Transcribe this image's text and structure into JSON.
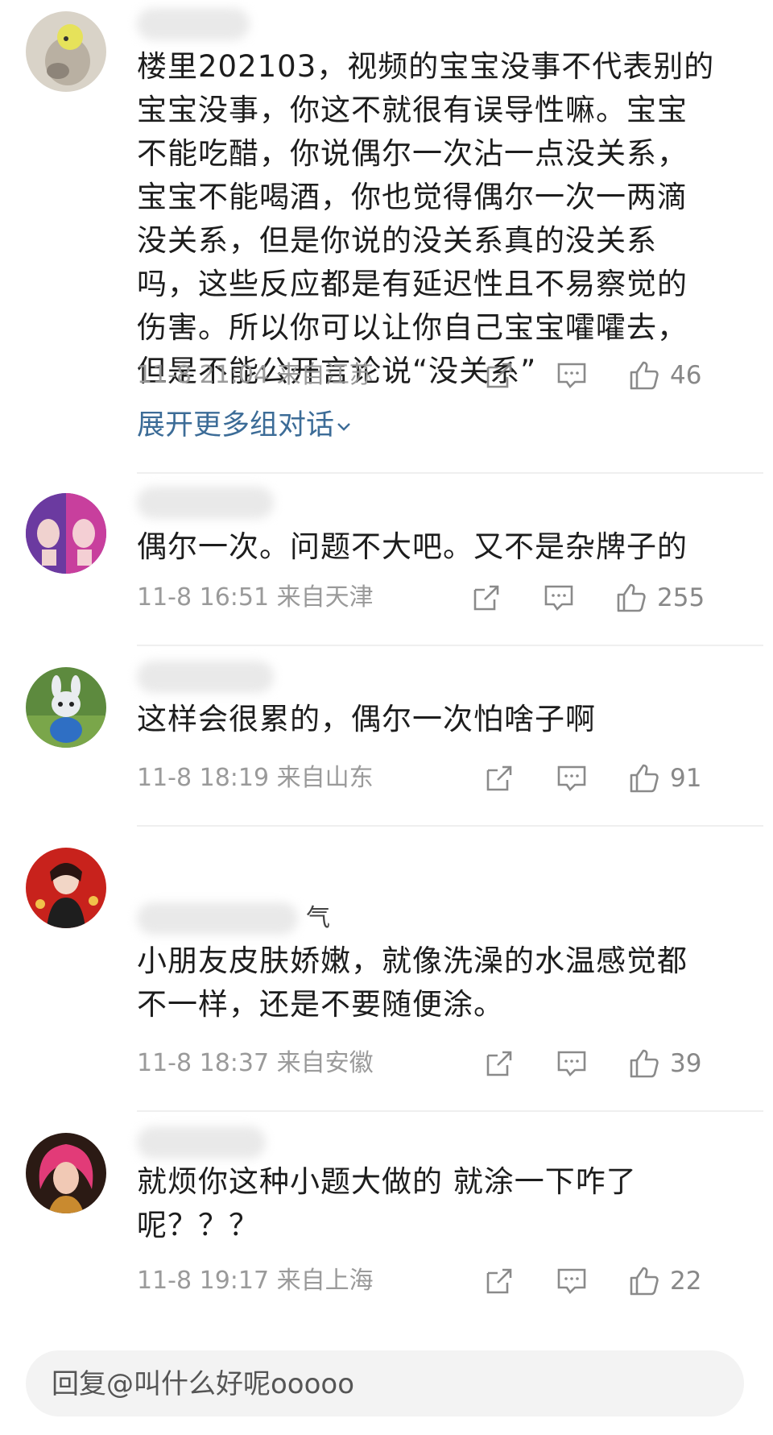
{
  "comments": [
    {
      "body": "楼里202103，视频的宝宝没事不代表别的\n宝宝没事，你这不就很有误导性嘛。宝宝\n不能吃醋，你说偶尔一次沾一点没关系，\n宝宝不能喝酒，你也觉得偶尔一次一两滴\n没关系，但是你说的没关系真的没关系\n吗，这些反应都是有延迟性且不易察觉的\n伤害。所以你可以让你自己宝宝嚯嚯去，\n但是不能公开言论说“没关系”",
      "time": "11-8 21:04",
      "location": "来自江苏",
      "likes": "46",
      "expand_label": "展开更多组对话"
    },
    {
      "body": "偶尔一次。问题不大吧。又不是杂牌子的",
      "time": "11-8 16:51",
      "location": "来自天津",
      "likes": "255"
    },
    {
      "body": "这样会很累的，偶尔一次怕啥子啊",
      "time": "11-8 18:19",
      "location": "来自山东",
      "likes": "91"
    },
    {
      "username_partial": "气",
      "body": "小朋友皮肤娇嫩，就像洗澡的水温感觉都\n不一样，还是不要随便涂。",
      "time": "11-8 18:37",
      "location": "来自安徽",
      "likes": "39"
    },
    {
      "body": "就烦你这种小题大做的 就涂一下咋了\n呢？？？",
      "time": "11-8 19:17",
      "location": "来自上海",
      "likes": "22"
    }
  ],
  "reply_bar": {
    "placeholder": "回复@叫什么好呢ooooo"
  },
  "icons": {
    "share": "share-icon",
    "comment": "comment-icon",
    "like": "like-icon",
    "expand": "chevron-down-icon"
  },
  "colors": {
    "meta_text": "#9a9a9a",
    "link_blue": "#3c6c97",
    "icon_gray": "#8a8a8a"
  }
}
